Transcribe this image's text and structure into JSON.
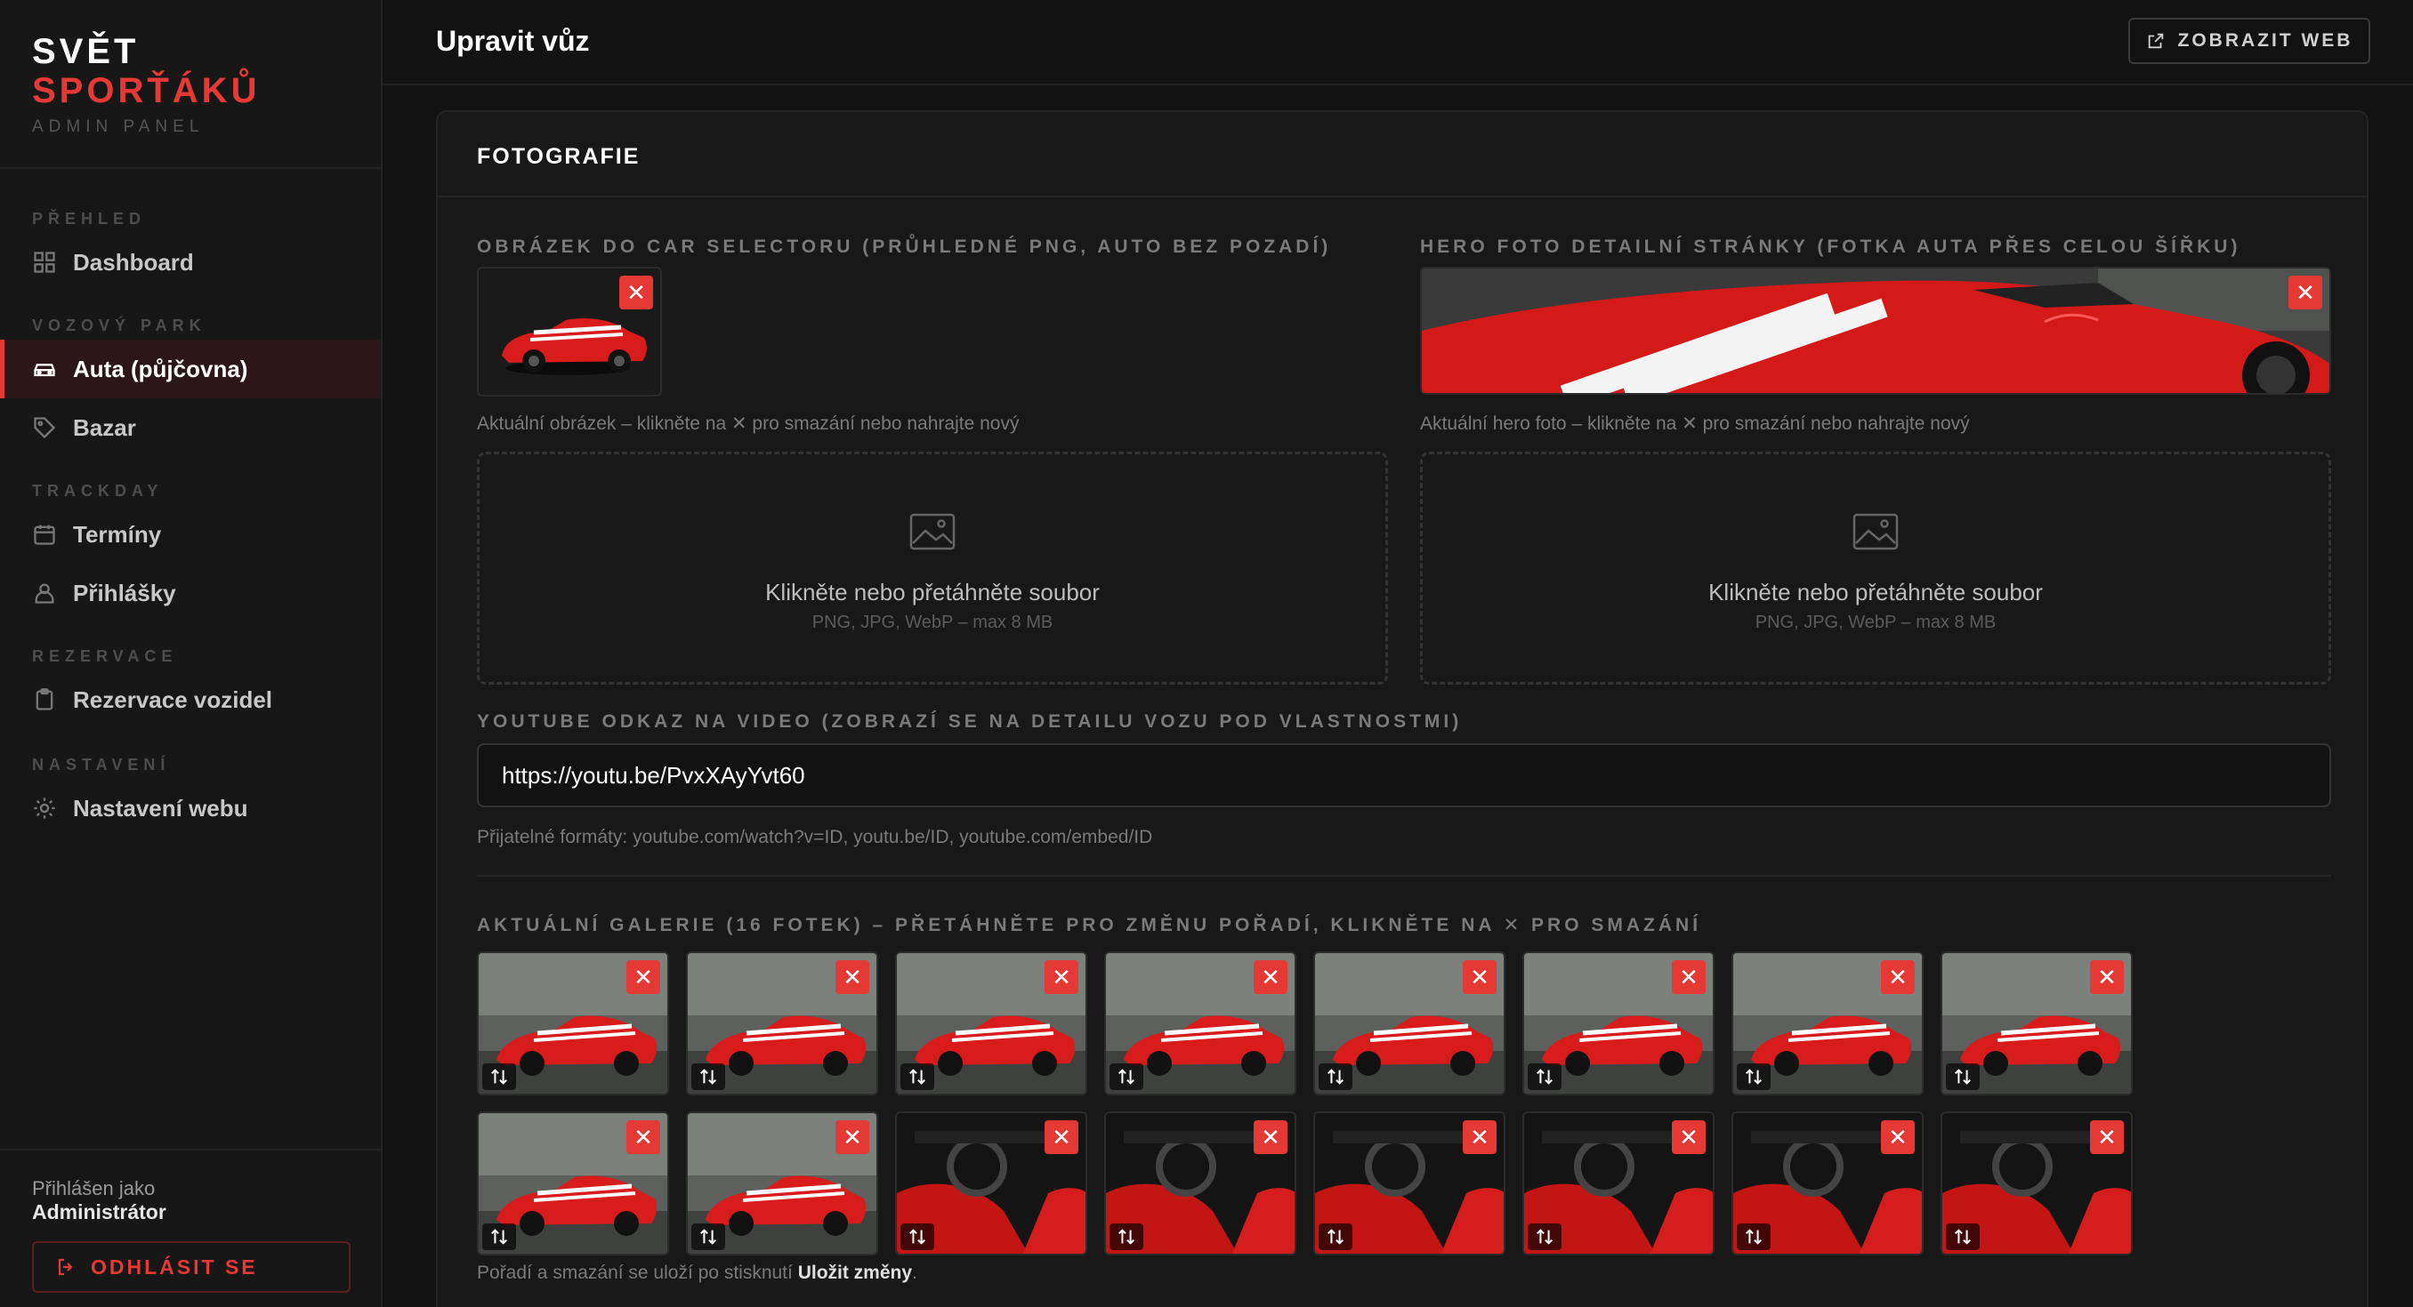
{
  "brand": {
    "line1": "SVĚT",
    "line2": "SPORŤÁKŮ",
    "sub": "ADMIN PANEL"
  },
  "nav": {
    "sections": [
      {
        "label": "PŘEHLED"
      },
      {
        "label": "VOZOVÝ PARK"
      },
      {
        "label": "TRACKDAY"
      },
      {
        "label": "REZERVACE"
      },
      {
        "label": "NASTAVENÍ"
      }
    ],
    "items": [
      {
        "label": "Dashboard",
        "icon": "grid-icon"
      },
      {
        "label": "Auta (půjčovna)",
        "icon": "car-icon",
        "active": true
      },
      {
        "label": "Bazar",
        "icon": "tag-icon"
      },
      {
        "label": "Termíny",
        "icon": "calendar-icon"
      },
      {
        "label": "Přihlášky",
        "icon": "user-icon"
      },
      {
        "label": "Rezervace vozidel",
        "icon": "clipboard-icon"
      },
      {
        "label": "Nastavení webu",
        "icon": "gear-icon"
      }
    ]
  },
  "user": {
    "logged_as_label": "Přihlášen jako",
    "name": "Administrátor",
    "logout_label": "ODHLÁSIT SE"
  },
  "topbar": {
    "title": "Upravit vůz",
    "view_web_label": "ZOBRAZIT WEB"
  },
  "card": {
    "title": "FOTOGRAFIE"
  },
  "selector_image": {
    "label": "OBRÁZEK DO CAR SELECTORU (PRŮHLEDNÉ PNG, AUTO BEZ POZADÍ)",
    "hint": "Aktuální obrázek – klikněte na ✕ pro smazání nebo nahrajte nový",
    "dropzone_title": "Klikněte nebo přetáhněte soubor",
    "dropzone_sub": "PNG, JPG, WebP – max 8 MB"
  },
  "hero_image": {
    "label": "HERO FOTO DETAILNÍ STRÁNKY (FOTKA AUTA PŘES CELOU ŠÍŘKU)",
    "hint": "Aktuální hero foto – klikněte na ✕ pro smazání nebo nahrajte nový",
    "dropzone_title": "Klikněte nebo přetáhněte soubor",
    "dropzone_sub": "PNG, JPG, WebP – max 8 MB"
  },
  "youtube": {
    "label": "YOUTUBE ODKAZ NA VIDEO (ZOBRAZÍ SE NA DETAILU VOZU POD VLASTNOSTMI)",
    "value": "https://youtu.be/PvxXAyYvt60",
    "hint": "Přijatelné formáty: youtube.com/watch?v=ID, youtu.be/ID, youtube.com/embed/ID"
  },
  "gallery": {
    "label": "AKTUÁLNÍ GALERIE (16 FOTEK) – PŘETÁHNĚTE PRO ZMĚNU POŘADÍ, KLIKNĚTE NA ✕ PRO SMAZÁNÍ",
    "footer_prefix": "Pořadí a smazání se uloží po stisknutí ",
    "footer_bold": "Uložit změny",
    "footer_suffix": ".",
    "photos": [
      {
        "scene": "exterior-front-3q"
      },
      {
        "scene": "exterior-front-3q"
      },
      {
        "scene": "exterior-hood"
      },
      {
        "scene": "exterior-front"
      },
      {
        "scene": "exterior-headlight"
      },
      {
        "scene": "exterior-side"
      },
      {
        "scene": "exterior-rear-3q"
      },
      {
        "scene": "exterior-rear"
      },
      {
        "scene": "exterior-rear"
      },
      {
        "scene": "exterior-side-detail"
      },
      {
        "scene": "interior-dash"
      },
      {
        "scene": "interior-seats"
      },
      {
        "scene": "interior-wheel"
      },
      {
        "scene": "interior-console"
      },
      {
        "scene": "interior-door"
      },
      {
        "scene": "interior-seats"
      }
    ]
  }
}
